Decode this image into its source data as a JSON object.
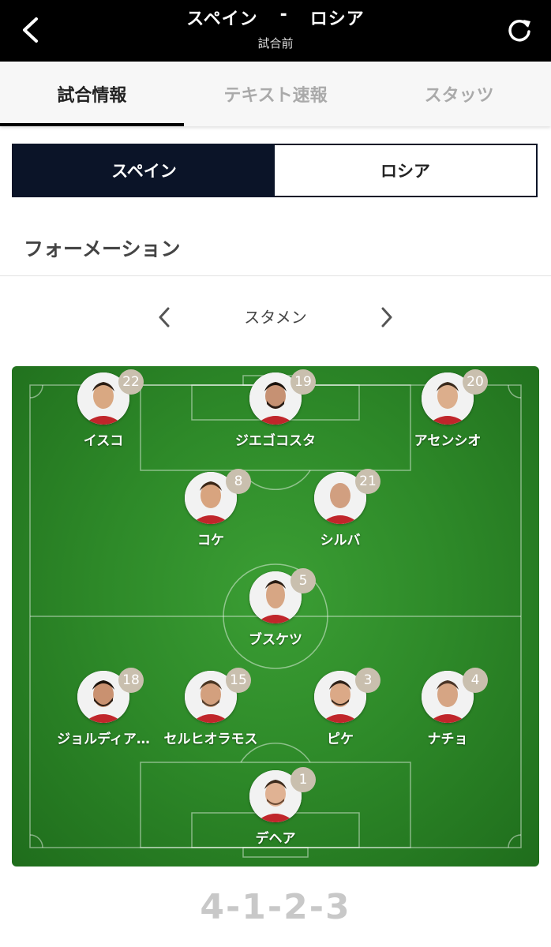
{
  "header": {
    "home_team": "スペイン",
    "separator": "-",
    "away_team": "ロシア",
    "status": "試合前",
    "back_icon": "chevron-left-icon",
    "refresh_icon": "refresh-icon"
  },
  "tabs": [
    {
      "label": "試合情報",
      "active": true
    },
    {
      "label": "テキスト速報",
      "active": false
    },
    {
      "label": "スタッツ",
      "active": false
    }
  ],
  "team_toggle": {
    "selected": "スペイン",
    "other": "ロシア"
  },
  "section": {
    "title": "フォーメーション"
  },
  "lineup_nav": {
    "label": "スタメン"
  },
  "players": [
    {
      "name": "イスコ",
      "number": "22"
    },
    {
      "name": "ジエゴコスタ",
      "number": "19"
    },
    {
      "name": "アセンシオ",
      "number": "20"
    },
    {
      "name": "コケ",
      "number": "8"
    },
    {
      "name": "シルバ",
      "number": "21"
    },
    {
      "name": "ブスケツ",
      "number": "5"
    },
    {
      "name": "ジョルディア…",
      "number": "18"
    },
    {
      "name": "セルヒオラモス",
      "number": "15"
    },
    {
      "name": "ピケ",
      "number": "3"
    },
    {
      "name": "ナチョ",
      "number": "4"
    },
    {
      "name": "デヘア",
      "number": "1"
    }
  ],
  "formation": {
    "text": "4-1-2-3"
  },
  "colors": {
    "header_bg": "#000000",
    "toggle_active": "#0b1428",
    "pitch_green": "#2e8a29",
    "badge": "#c9bfae"
  }
}
